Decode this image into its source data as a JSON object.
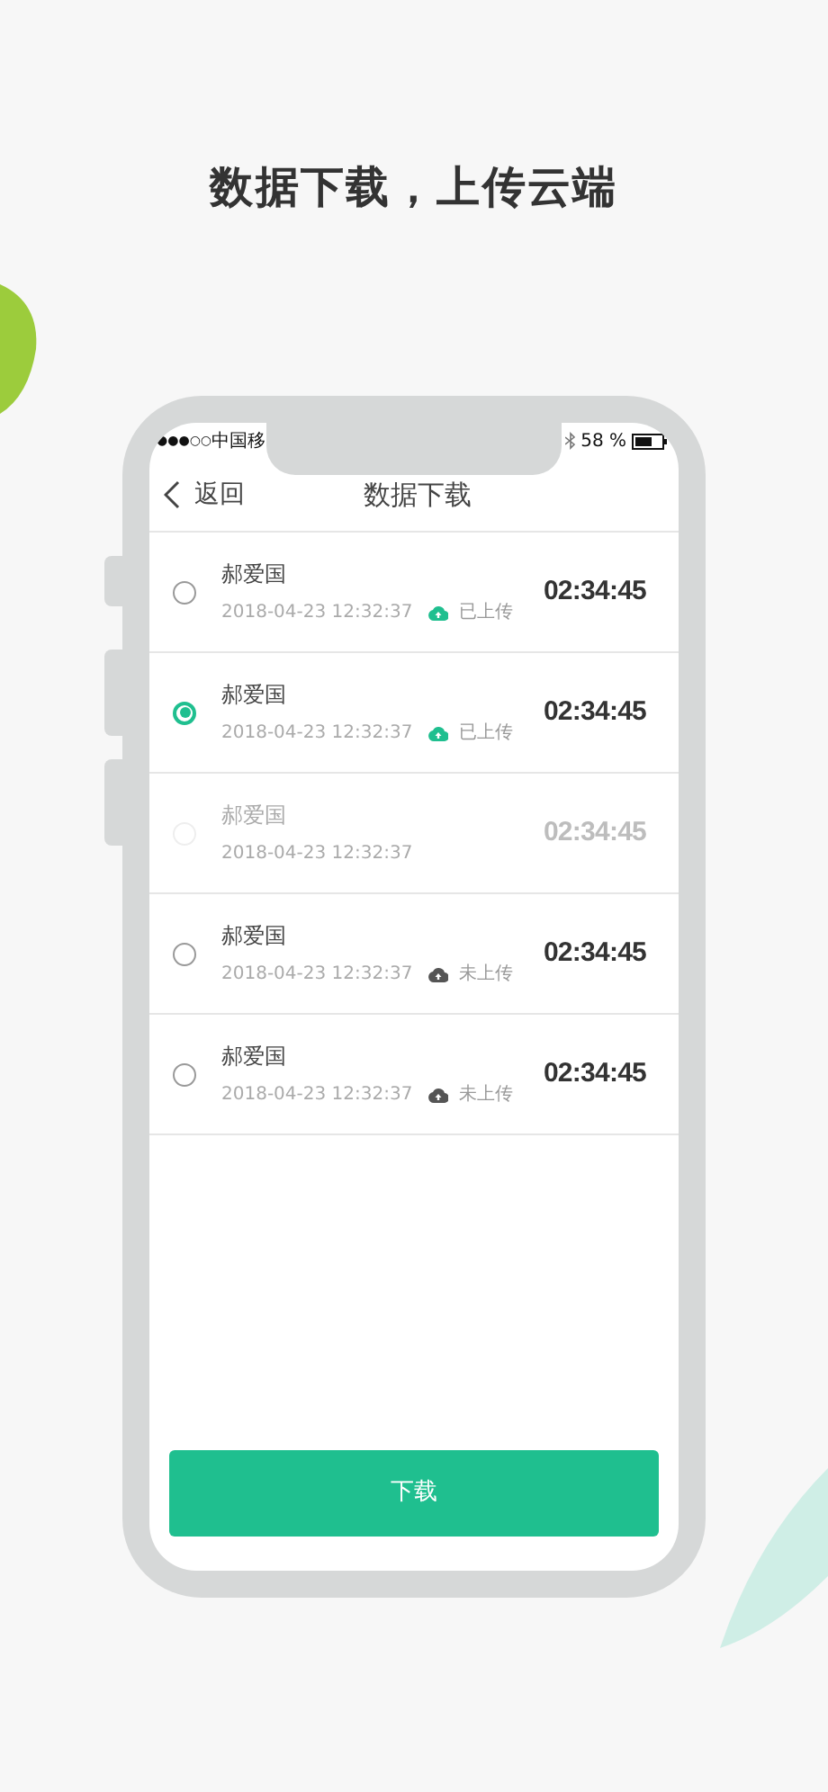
{
  "headline": "数据下载，上传云端",
  "status_bar": {
    "signal": "●●●○○",
    "carrier": "中国移",
    "battery": "58 %"
  },
  "nav": {
    "back": "返回",
    "title": "数据下载"
  },
  "records": [
    {
      "name": "郝爱国",
      "date": "2018-04-23 12:32:37",
      "upload": {
        "kind": "uploaded",
        "label": "已上传"
      },
      "time": "02:34:45",
      "selected": false,
      "disabled": false
    },
    {
      "name": "郝爱国",
      "date": "2018-04-23 12:32:37",
      "upload": {
        "kind": "uploaded",
        "label": "已上传"
      },
      "time": "02:34:45",
      "selected": true,
      "disabled": false
    },
    {
      "name": "郝爱国",
      "date": "2018-04-23 12:32:37",
      "time": "02:34:45",
      "selected": false,
      "disabled": true
    },
    {
      "name": "郝爱国",
      "date": "2018-04-23 12:32:37",
      "upload": {
        "kind": "pending",
        "label": "未上传"
      },
      "time": "02:34:45",
      "selected": false,
      "disabled": false
    },
    {
      "name": "郝爱国",
      "date": "2018-04-23 12:32:37",
      "upload": {
        "kind": "pending",
        "label": "未上传"
      },
      "time": "02:34:45",
      "selected": false,
      "disabled": false
    }
  ],
  "download_button": "下载"
}
